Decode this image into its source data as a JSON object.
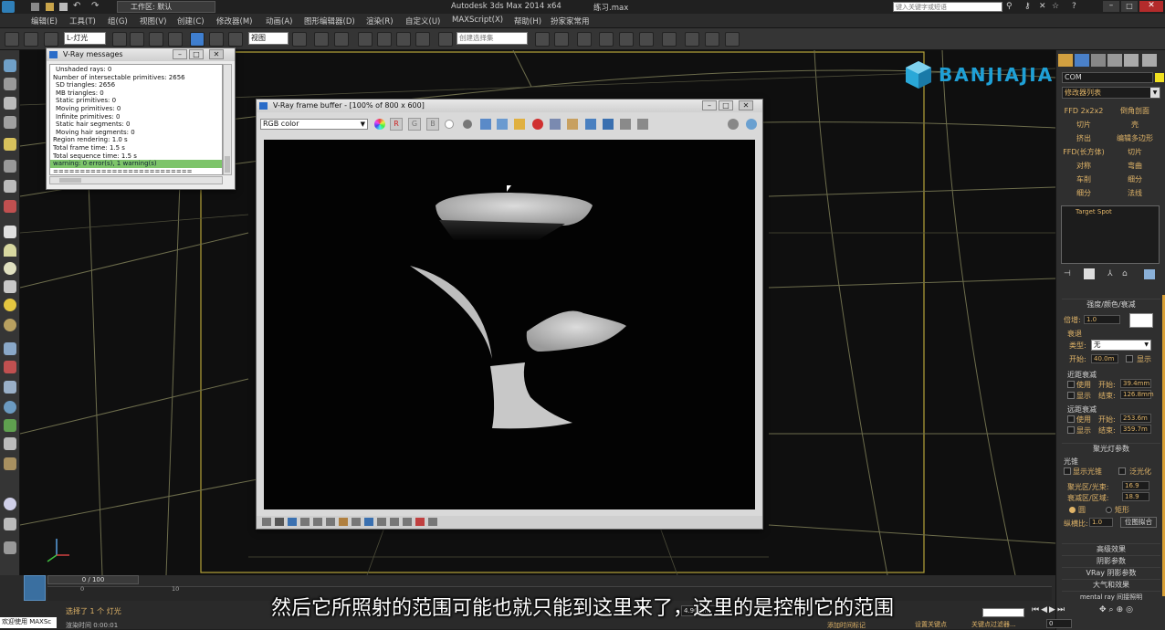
{
  "app": {
    "title": "Autodesk 3ds Max  2014 x64",
    "filename": "练习.max",
    "workspace": "工作区: 默认",
    "help_search_placeholder": "键入关键字或短语"
  },
  "menu": [
    "编辑(E)",
    "工具(T)",
    "组(G)",
    "视图(V)",
    "创建(C)",
    "修改器(M)",
    "动画(A)",
    "图形编辑器(D)",
    "渲染(R)",
    "自定义(U)",
    "MAXScript(X)",
    "帮助(H)",
    "扮家家常用"
  ],
  "toolbar": {
    "selection_filter": "L-灯光",
    "view_dropdown": "视图",
    "selection_set": "创建选择集"
  },
  "vray_messages": {
    "title": "V-Ray messages",
    "lines": [
      "Unshaded rays: 0",
      "Number of intersectable primitives: 2656",
      "SD triangles: 2656",
      "MB triangles: 0",
      "Static primitives: 0",
      "Moving primitives: 0",
      "Infinite primitives: 0",
      "Static hair segments: 0",
      "Moving hair segments: 0",
      "Region rendering: 1.0 s",
      "Total frame time: 1.5 s",
      "Total sequence time: 1.5 s",
      "warning: 0 error(s), 1 warning(s)",
      "=========================="
    ]
  },
  "vray_fb": {
    "title": "V-Ray frame buffer - [100% of 800 x 600]",
    "channel": "RGB color",
    "r": "R",
    "g": "G",
    "b": "B"
  },
  "logo": {
    "text": "BANJIAJIA",
    "suffix": "COM"
  },
  "right_panel": {
    "modifier_list": "修改器列表",
    "buttons": [
      "FFD 2x2x2",
      "倒角剖面",
      "切片",
      "壳",
      "挤出",
      "编辑多边形",
      "FFD(长方体)",
      "切片",
      "对称",
      "弯曲",
      "车削",
      "细分",
      "细分",
      "法线"
    ],
    "stack_item": "Target Spot",
    "rollout_intensity": "强度/颜色/衰减",
    "multiplier_label": "倍增:",
    "multiplier_value": "1.0",
    "decay_label": "衰退",
    "type_label": "类型:",
    "type_value": "无",
    "start_label": "开始:",
    "start_value": "40.0m",
    "show_label": "显示",
    "near_atten": "近距衰减",
    "use_label": "使用",
    "near_start": "39.4mm",
    "near_end": "126.8mm",
    "end_label": "结束:",
    "far_atten": "远距衰减",
    "far_start": "253.6m",
    "far_end": "359.7m",
    "rollout_spot": "聚光灯参数",
    "light_cone": "光锥",
    "show_cone": "显示光锥",
    "overshoot": "泛光化",
    "hotspot_label": "聚光区/光束:",
    "hotspot_value": "16.9",
    "falloff_label": "衰减区/区域:",
    "falloff_value": "18.9",
    "circle": "圆",
    "rectangle": "矩形",
    "aspect_label": "纵横比:",
    "aspect_value": "1.0",
    "bitmap_fit": "位图拟合",
    "rollouts_bottom": [
      "高级效果",
      "阴影参数",
      "VRay 阴影参数",
      "大气和效果",
      "mental ray 间接照明"
    ]
  },
  "timeline": {
    "frame_range": "0 / 100",
    "ticks": [
      "0",
      "10"
    ],
    "status_selected": "选择了 1 个 灯光",
    "status_render_time": "渲染时间 0:00:01",
    "welcome": "欢迎使用 MAXSc",
    "add_time_tag": "添加时间标记",
    "set_key": "设置关键点",
    "key_filter": "关键点过滤器...",
    "frame_value": "0",
    "grid": "4.90mm"
  },
  "subtitle": "然后它所照射的范围可能也就只能到这里来了，这里的是控制它的范围"
}
